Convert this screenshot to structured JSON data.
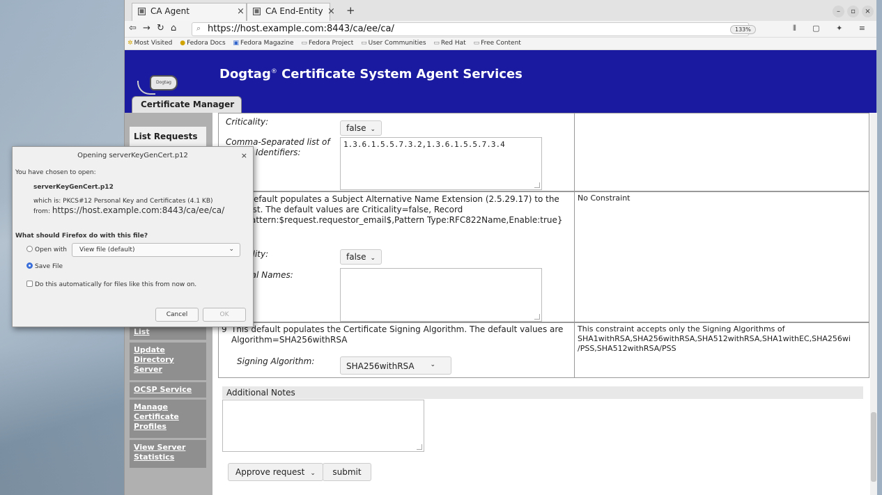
{
  "browser": {
    "tabs": [
      {
        "label": "CA Agent",
        "favicon": "certificate-icon"
      },
      {
        "label": "CA End-Entity",
        "favicon": "certificate-icon"
      }
    ],
    "url": "https://host.example.com:8443/ca/ee/ca/",
    "zoom": "133%",
    "bookmarks": [
      "Most Visited",
      "Fedora Docs",
      "Fedora Magazine",
      "Fedora Project",
      "User Communities",
      "Red Hat",
      "Free Content"
    ]
  },
  "page": {
    "banner_title": "Dogtag",
    "banner_reg": "®",
    "banner_rest": " Certificate System Agent Services",
    "logo_text": "Dogtag",
    "section_tab": "Certificate Manager"
  },
  "sidebar": {
    "list_requests": "List Requests",
    "list": "List",
    "update_directory": "Update Directory Server",
    "ocsp": "OCSP Service",
    "manage_profiles": "Manage Certificate Profiles",
    "view_stats": "View Server Statistics"
  },
  "policy": {
    "row_a": {
      "criticality_label": "Criticality:",
      "criticality_value": "false",
      "oid_label": "Comma-Separated list of Object Identifiers:",
      "oid_value": "1.3.6.1.5.5.7.3.2,1.3.6.1.5.5.7.3.4"
    },
    "row_b": {
      "description": "This default populates a Subject Alternative Name Extension (2.5.29.17) to the request. The default values are Criticality=false, Record #0{Pattern:$request.requestor_email$,Pattern Type:RFC822Name,Enable:true}",
      "constraint": "No Constraint",
      "criticality_label": "Criticality:",
      "criticality_value": "false",
      "general_names_label": "General Names:"
    },
    "row_c": {
      "number": "9",
      "description": "This default populates the Certificate Signing Algorithm. The default values are Algorithm=SHA256withRSA",
      "constraint_line1": "This constraint accepts only the Signing Algorithms of",
      "constraint_line2": "SHA1withRSA,SHA256withRSA,SHA512withRSA,SHA1withEC,SHA256wi",
      "constraint_line3": "/PSS,SHA512withRSA/PSS",
      "signing_label": "Signing Algorithm:",
      "signing_value": "SHA256withRSA"
    }
  },
  "notes": {
    "header": "Additional Notes"
  },
  "actions": {
    "approve": "Approve request",
    "submit": "submit"
  },
  "dialog": {
    "title": "Opening serverKeyGenCert.p12",
    "chosen": "You have chosen to open:",
    "filename": "serverKeyGenCert.p12",
    "which_is": "which is: PKCS#12 Personal Key and Certificates (4.1 KB)",
    "from_label": "from:",
    "from_value": "https://host.example.com:8443/ca/ee/ca/",
    "question": "What should Firefox do with this file?",
    "open_with_label": "Open with",
    "open_with_value": "View file (default)",
    "save_file": "Save File",
    "auto": "Do this automatically for files like this from now on.",
    "cancel": "Cancel",
    "ok": "OK"
  }
}
